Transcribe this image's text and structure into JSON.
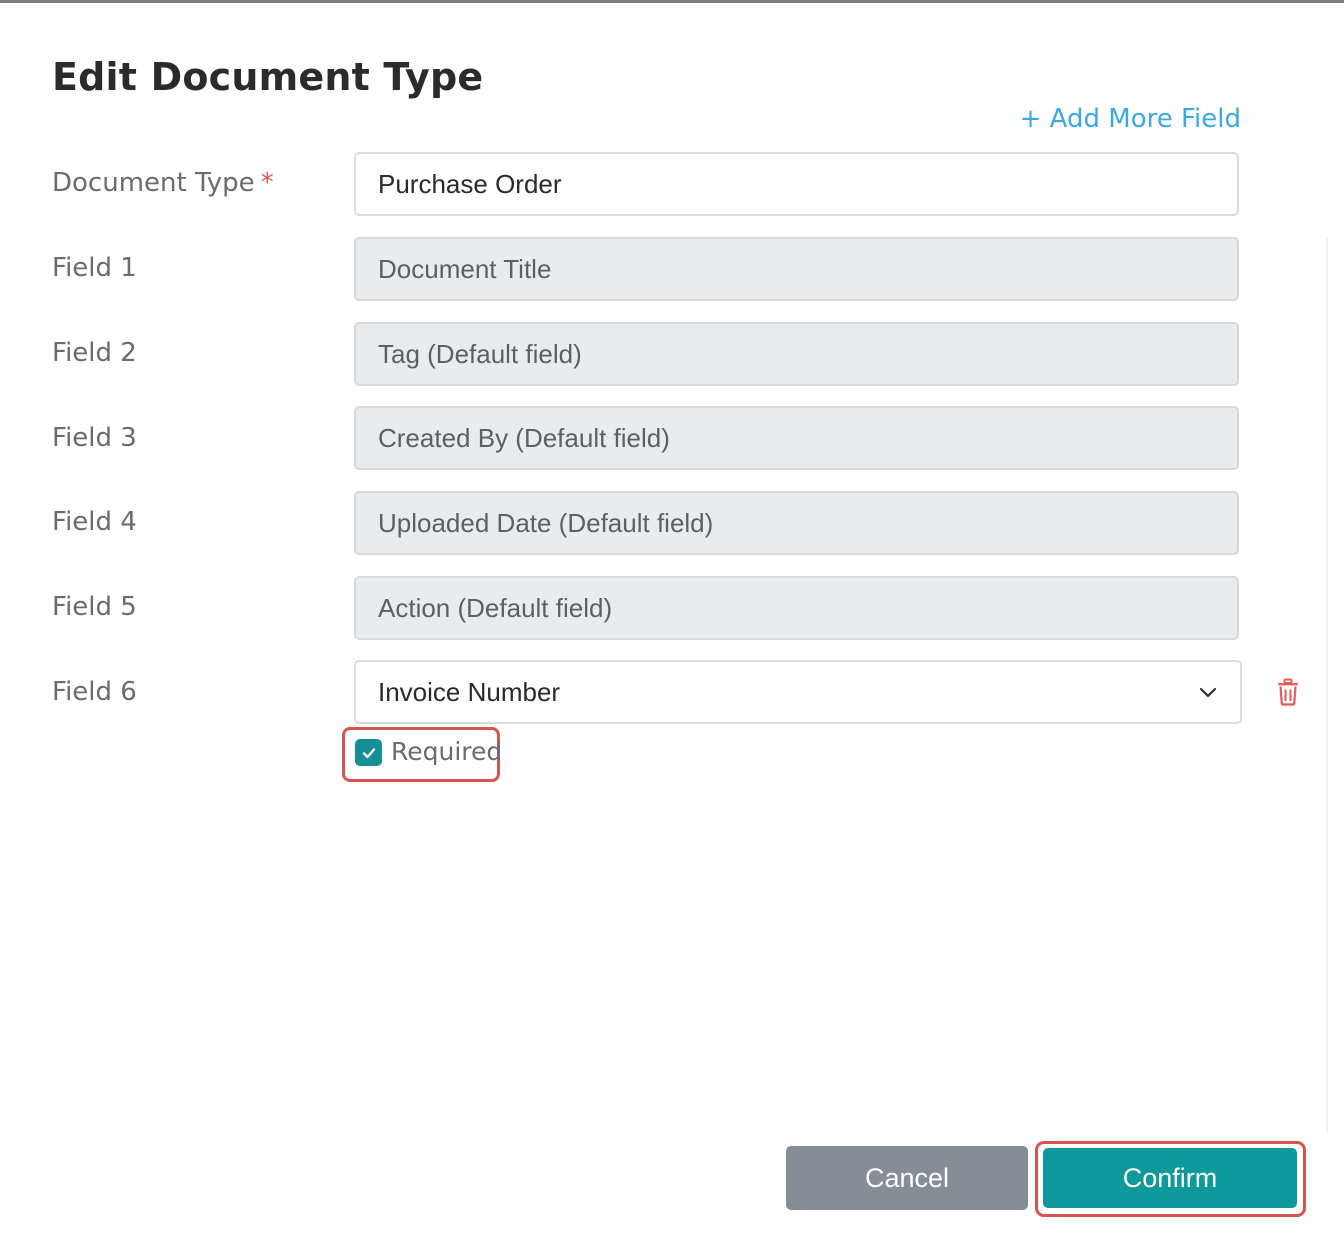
{
  "dialog": {
    "title": "Edit Document Type",
    "add_more_label": "+ Add More Field"
  },
  "document_type": {
    "label": "Document Type",
    "required_marker": "*",
    "value": "Purchase Order"
  },
  "fields": [
    {
      "label": "Field 1",
      "value": "Document Title"
    },
    {
      "label": "Field 2",
      "value": "Tag (Default field)"
    },
    {
      "label": "Field 3",
      "value": "Created By (Default field)"
    },
    {
      "label": "Field 4",
      "value": "Uploaded Date (Default field)"
    },
    {
      "label": "Field 5",
      "value": "Action (Default field)"
    },
    {
      "label": "Field 6",
      "value": "Invoice Number"
    }
  ],
  "required_checkbox": {
    "label": "Required",
    "checked": true
  },
  "buttons": {
    "cancel": "Cancel",
    "confirm": "Confirm"
  },
  "colors": {
    "accent": "#10999c",
    "link": "#3ba9e6",
    "danger": "#e35b5b",
    "cancel_bg": "#868d95"
  },
  "icons": {
    "dropdown": "chevron-down-icon",
    "delete": "trash-icon",
    "check": "check-icon"
  }
}
